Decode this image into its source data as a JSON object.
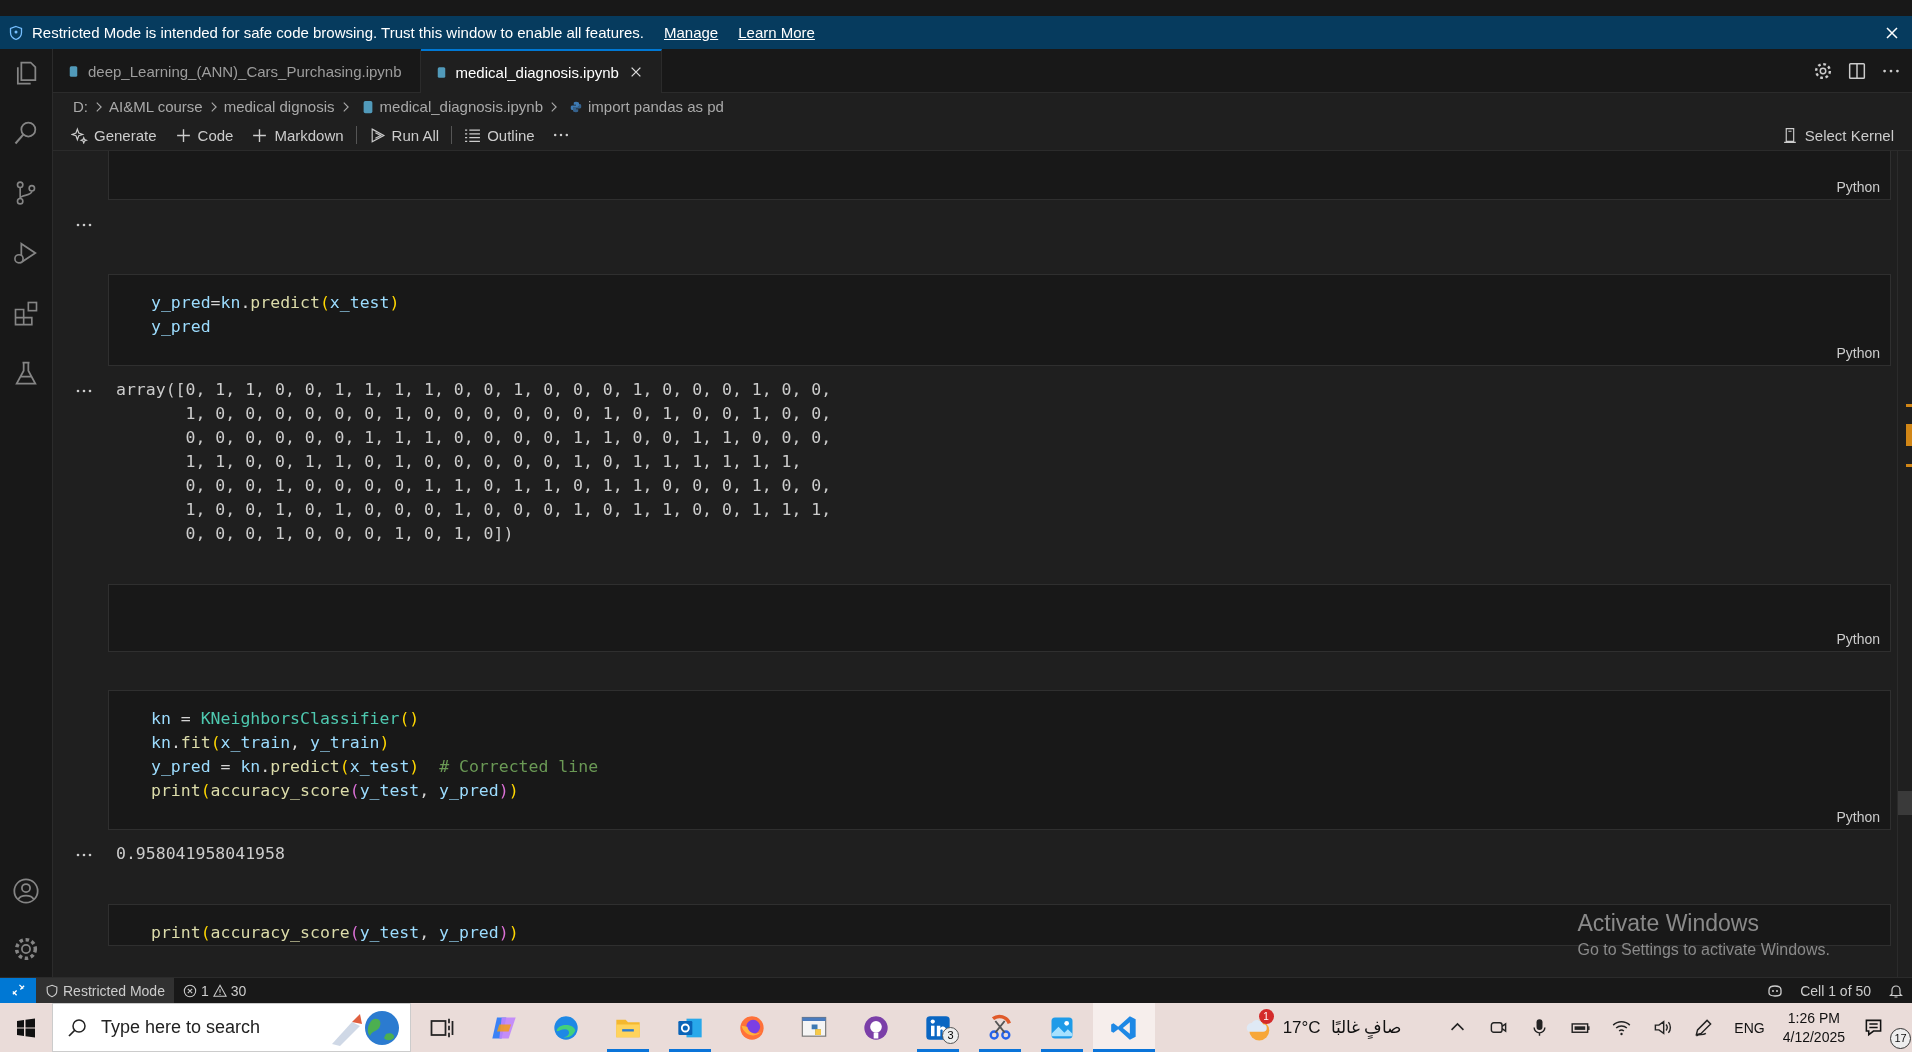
{
  "banner": {
    "message": "Restricted Mode is intended for safe code browsing. Trust this window to enable all features.",
    "links": [
      "Manage",
      "Learn More"
    ]
  },
  "tabs": [
    {
      "label": "deep_Learning_(ANN)_Cars_Purchasing.ipynb",
      "selected": false
    },
    {
      "label": "medical_diagnosis.ipynb",
      "selected": true
    }
  ],
  "breadcrumbs": [
    {
      "label": "D:",
      "kind": "folder"
    },
    {
      "label": "AI&ML course",
      "kind": "folder"
    },
    {
      "label": "medical dignosis",
      "kind": "folder"
    },
    {
      "label": "medical_diagnosis.ipynb",
      "kind": "notebook"
    },
    {
      "label": "import pandas as pd",
      "kind": "python"
    }
  ],
  "toolbar": [
    {
      "label": "Generate",
      "kind": "generate"
    },
    {
      "label": "Code",
      "kind": "add"
    },
    {
      "label": "Markdown",
      "kind": "add"
    },
    {
      "label": "Run All",
      "kind": "run"
    },
    {
      "label": "Outline",
      "kind": "outline"
    }
  ],
  "kernel": "Select Kernel",
  "cells": [
    {
      "kind": "code",
      "language": "Python"
    },
    {
      "kind": "output"
    },
    {
      "kind": "code",
      "language": "Python",
      "lines": [
        {
          "tokens": [
            {
              "kind": "var",
              "text": "y_pred"
            },
            {
              "kind": "plain",
              "text": "="
            },
            {
              "kind": "var",
              "text": "kn"
            },
            {
              "kind": "plain",
              "text": "."
            },
            {
              "kind": "func",
              "text": "predict"
            },
            {
              "kind": "bracket",
              "text": "("
            },
            {
              "kind": "var",
              "text": "x_test"
            },
            {
              "kind": "bracket",
              "text": ")"
            }
          ]
        },
        {
          "tokens": [
            {
              "kind": "var",
              "text": "y_pred"
            }
          ]
        }
      ]
    },
    {
      "kind": "output",
      "lines": [
        "array([0, 1, 1, 0, 0, 1, 1, 1, 1, 0, 0, 1, 0, 0, 0, 1, 0, 0, 0, 1, 0, 0,",
        "       1, 0, 0, 0, 0, 0, 0, 1, 0, 0, 0, 0, 0, 0, 1, 0, 1, 0, 0, 1, 0, 0,",
        "       0, 0, 0, 0, 0, 0, 1, 1, 1, 0, 0, 0, 0, 1, 1, 0, 0, 1, 1, 0, 0, 0,",
        "       1, 1, 0, 0, 1, 1, 0, 1, 0, 0, 0, 0, 0, 1, 0, 1, 1, 1, 1, 1, 1,",
        "       0, 0, 0, 1, 0, 0, 0, 0, 1, 1, 0, 1, 1, 0, 1, 1, 0, 0, 0, 1, 0, 0,",
        "       1, 0, 0, 1, 0, 1, 0, 0, 0, 1, 0, 0, 0, 1, 0, 1, 1, 0, 0, 1, 1, 1,",
        "       0, 0, 0, 1, 0, 0, 0, 1, 0, 1, 0])"
      ]
    },
    {
      "kind": "code",
      "language": "Python"
    },
    {
      "kind": "code",
      "language": "Python",
      "lines": [
        {
          "tokens": [
            {
              "kind": "var",
              "text": "kn"
            },
            {
              "kind": "plain",
              "text": " = "
            },
            {
              "kind": "class",
              "text": "KNeighborsClassifier"
            },
            {
              "kind": "bracket",
              "text": "()"
            }
          ]
        },
        {
          "tokens": [
            {
              "kind": "var",
              "text": "kn"
            },
            {
              "kind": "plain",
              "text": "."
            },
            {
              "kind": "func",
              "text": "fit"
            },
            {
              "kind": "bracket",
              "text": "("
            },
            {
              "kind": "var",
              "text": "x_train"
            },
            {
              "kind": "plain",
              "text": ", "
            },
            {
              "kind": "var",
              "text": "y_train"
            },
            {
              "kind": "bracket",
              "text": ")"
            }
          ]
        },
        {
          "tokens": [
            {
              "kind": "var",
              "text": "y_pred"
            },
            {
              "kind": "plain",
              "text": " = "
            },
            {
              "kind": "var",
              "text": "kn"
            },
            {
              "kind": "plain",
              "text": "."
            },
            {
              "kind": "func",
              "text": "predict"
            },
            {
              "kind": "bracket",
              "text": "("
            },
            {
              "kind": "var",
              "text": "x_test"
            },
            {
              "kind": "bracket",
              "text": ")"
            },
            {
              "kind": "comment",
              "text": "  # Corrected line"
            }
          ]
        },
        {
          "tokens": [
            {
              "kind": "func",
              "text": "print"
            },
            {
              "kind": "bracket",
              "text": "("
            },
            {
              "kind": "func",
              "text": "accuracy_score"
            },
            {
              "kind": "bracket2",
              "text": "("
            },
            {
              "kind": "var",
              "text": "y_test"
            },
            {
              "kind": "plain",
              "text": ", "
            },
            {
              "kind": "var",
              "text": "y_pred"
            },
            {
              "kind": "bracket2",
              "text": ")"
            },
            {
              "kind": "bracket",
              "text": ")"
            }
          ]
        }
      ]
    },
    {
      "kind": "output",
      "lines": [
        "0.958041958041958"
      ]
    },
    {
      "kind": "code",
      "lines": [
        {
          "tokens": [
            {
              "kind": "func",
              "text": "print"
            },
            {
              "kind": "bracket",
              "text": "("
            },
            {
              "kind": "func",
              "text": "accuracy_score"
            },
            {
              "kind": "bracket2",
              "text": "("
            },
            {
              "kind": "var",
              "text": "y_test"
            },
            {
              "kind": "plain",
              "text": ", "
            },
            {
              "kind": "var",
              "text": "y_pred"
            },
            {
              "kind": "bracket2",
              "text": ")"
            },
            {
              "kind": "bracket",
              "text": ")"
            }
          ]
        }
      ]
    }
  ],
  "activation": {
    "title": "Activate Windows",
    "hint": "Go to Settings to activate Windows."
  },
  "status_bar": {
    "mode": "Restricted Mode",
    "errors": "1",
    "warnings": "30",
    "cell": "Cell 1 of 50"
  },
  "taskbar": {
    "search_placeholder": "Type here to search",
    "apps": [
      {
        "kind": "taskview",
        "running": false,
        "selected": false
      },
      {
        "kind": "copilot",
        "running": false,
        "selected": false
      },
      {
        "kind": "edge",
        "running": false,
        "selected": false
      },
      {
        "kind": "files",
        "running": true,
        "selected": false
      },
      {
        "kind": "outlook",
        "running": true,
        "selected": false
      },
      {
        "kind": "firefox",
        "running": false,
        "selected": false
      },
      {
        "kind": "python",
        "running": false,
        "selected": false
      },
      {
        "kind": "github",
        "running": false,
        "selected": false
      },
      {
        "kind": "linkedin",
        "running": true,
        "selected": false,
        "badge": "3"
      },
      {
        "kind": "snipping",
        "running": true,
        "selected": false
      },
      {
        "kind": "photos",
        "running": true,
        "selected": false
      },
      {
        "kind": "vscode",
        "running": true,
        "selected": true
      }
    ],
    "weather": {
      "badge": "1",
      "temperature": "17°C",
      "condition": "صافٍ غالبًا"
    },
    "language": "ENG",
    "time": "1:26 PM",
    "date": "4/12/2025",
    "notifications": "17"
  }
}
